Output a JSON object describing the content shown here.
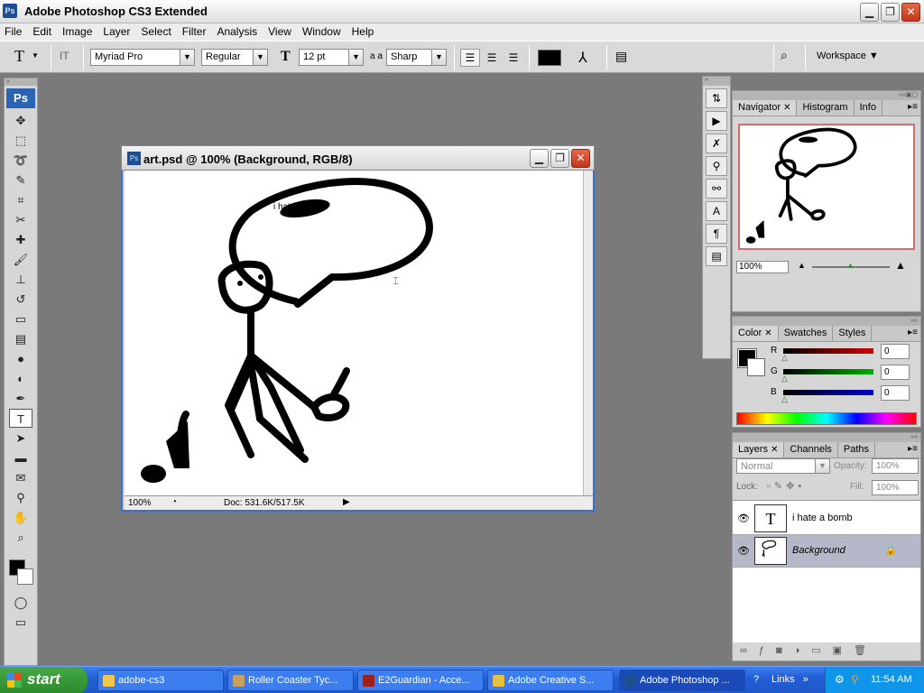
{
  "app": {
    "title": "Adobe Photoshop CS3 Extended",
    "logo_text": "Ps"
  },
  "window_controls": {
    "minimize": "▁",
    "maximize": "❐",
    "close": "✕"
  },
  "menu": [
    "File",
    "Edit",
    "Image",
    "Layer",
    "Select",
    "Filter",
    "Analysis",
    "View",
    "Window",
    "Help"
  ],
  "options_bar": {
    "tool_glyph": "T",
    "orient_glyph": "IT",
    "font_family": "Myriad Pro",
    "font_style": "Regular",
    "size_icon_text": "T",
    "font_size": "12 pt",
    "aa_icon_text": "a a",
    "anti_alias": "Sharp",
    "workspace_label": "Workspace ▼",
    "text_color": "#000000"
  },
  "toolbox": {
    "logo_text": "Ps",
    "tools": [
      {
        "name": "move-tool-icon",
        "glyph": "✥"
      },
      {
        "name": "marquee-tool-icon",
        "glyph": "⬚"
      },
      {
        "name": "lasso-tool-icon",
        "glyph": "➰"
      },
      {
        "name": "quick-selection-tool-icon",
        "glyph": "✎"
      },
      {
        "name": "crop-tool-icon",
        "glyph": "⌗"
      },
      {
        "name": "slice-tool-icon",
        "glyph": "✂"
      },
      {
        "name": "healing-brush-tool-icon",
        "glyph": "✚"
      },
      {
        "name": "brush-tool-icon",
        "glyph": "🖌"
      },
      {
        "name": "clone-stamp-tool-icon",
        "glyph": "⊥"
      },
      {
        "name": "history-brush-tool-icon",
        "glyph": "↺"
      },
      {
        "name": "eraser-tool-icon",
        "glyph": "▭"
      },
      {
        "name": "gradient-tool-icon",
        "glyph": "▤"
      },
      {
        "name": "blur-tool-icon",
        "glyph": "●"
      },
      {
        "name": "dodge-tool-icon",
        "glyph": "◐"
      },
      {
        "name": "pen-tool-icon",
        "glyph": "✒"
      },
      {
        "name": "type-tool-icon",
        "glyph": "T",
        "active": true
      },
      {
        "name": "path-selection-tool-icon",
        "glyph": "➤"
      },
      {
        "name": "shape-tool-icon",
        "glyph": "▬"
      },
      {
        "name": "notes-tool-icon",
        "glyph": "✉"
      },
      {
        "name": "eyedropper-tool-icon",
        "glyph": "⚲"
      },
      {
        "name": "hand-tool-icon",
        "glyph": "✋"
      },
      {
        "name": "zoom-tool-icon",
        "glyph": "⌕"
      }
    ]
  },
  "document": {
    "title": "art.psd @ 100% (Background, RGB/8)",
    "zoom": "100%",
    "doc_info": "Doc: 531.6K/517.5K",
    "text_layer_visible_text": "i hate a bomb"
  },
  "navigator_panel": {
    "tabs": [
      "Navigator",
      "Histogram",
      "Info"
    ],
    "zoom": "100%"
  },
  "color_panel": {
    "tabs": [
      "Color",
      "Swatches",
      "Styles"
    ],
    "channels": [
      {
        "label": "R",
        "value": "0",
        "color": "#d00000"
      },
      {
        "label": "G",
        "value": "0",
        "color": "#00b000"
      },
      {
        "label": "B",
        "value": "0",
        "color": "#0000d0"
      }
    ]
  },
  "layers_panel": {
    "tabs": [
      "Layers",
      "Channels",
      "Paths"
    ],
    "blend_mode": "Normal",
    "opacity_label": "Opacity:",
    "opacity": "100%",
    "lock_label": "Lock:",
    "fill_label": "Fill:",
    "fill": "100%",
    "layers": [
      {
        "name": "i hate a bomb",
        "thumb": "T"
      },
      {
        "name": "Background",
        "thumb": ""
      }
    ]
  },
  "taskbar": {
    "start_label": "start",
    "tasks": [
      "adobe-cs3",
      "Roller Coaster Tyc...",
      "E2Guardian - Acce...",
      "Adobe Creative S...",
      "Adobe Photoshop ..."
    ],
    "links_label": "Links",
    "clock": "11:54 AM"
  }
}
